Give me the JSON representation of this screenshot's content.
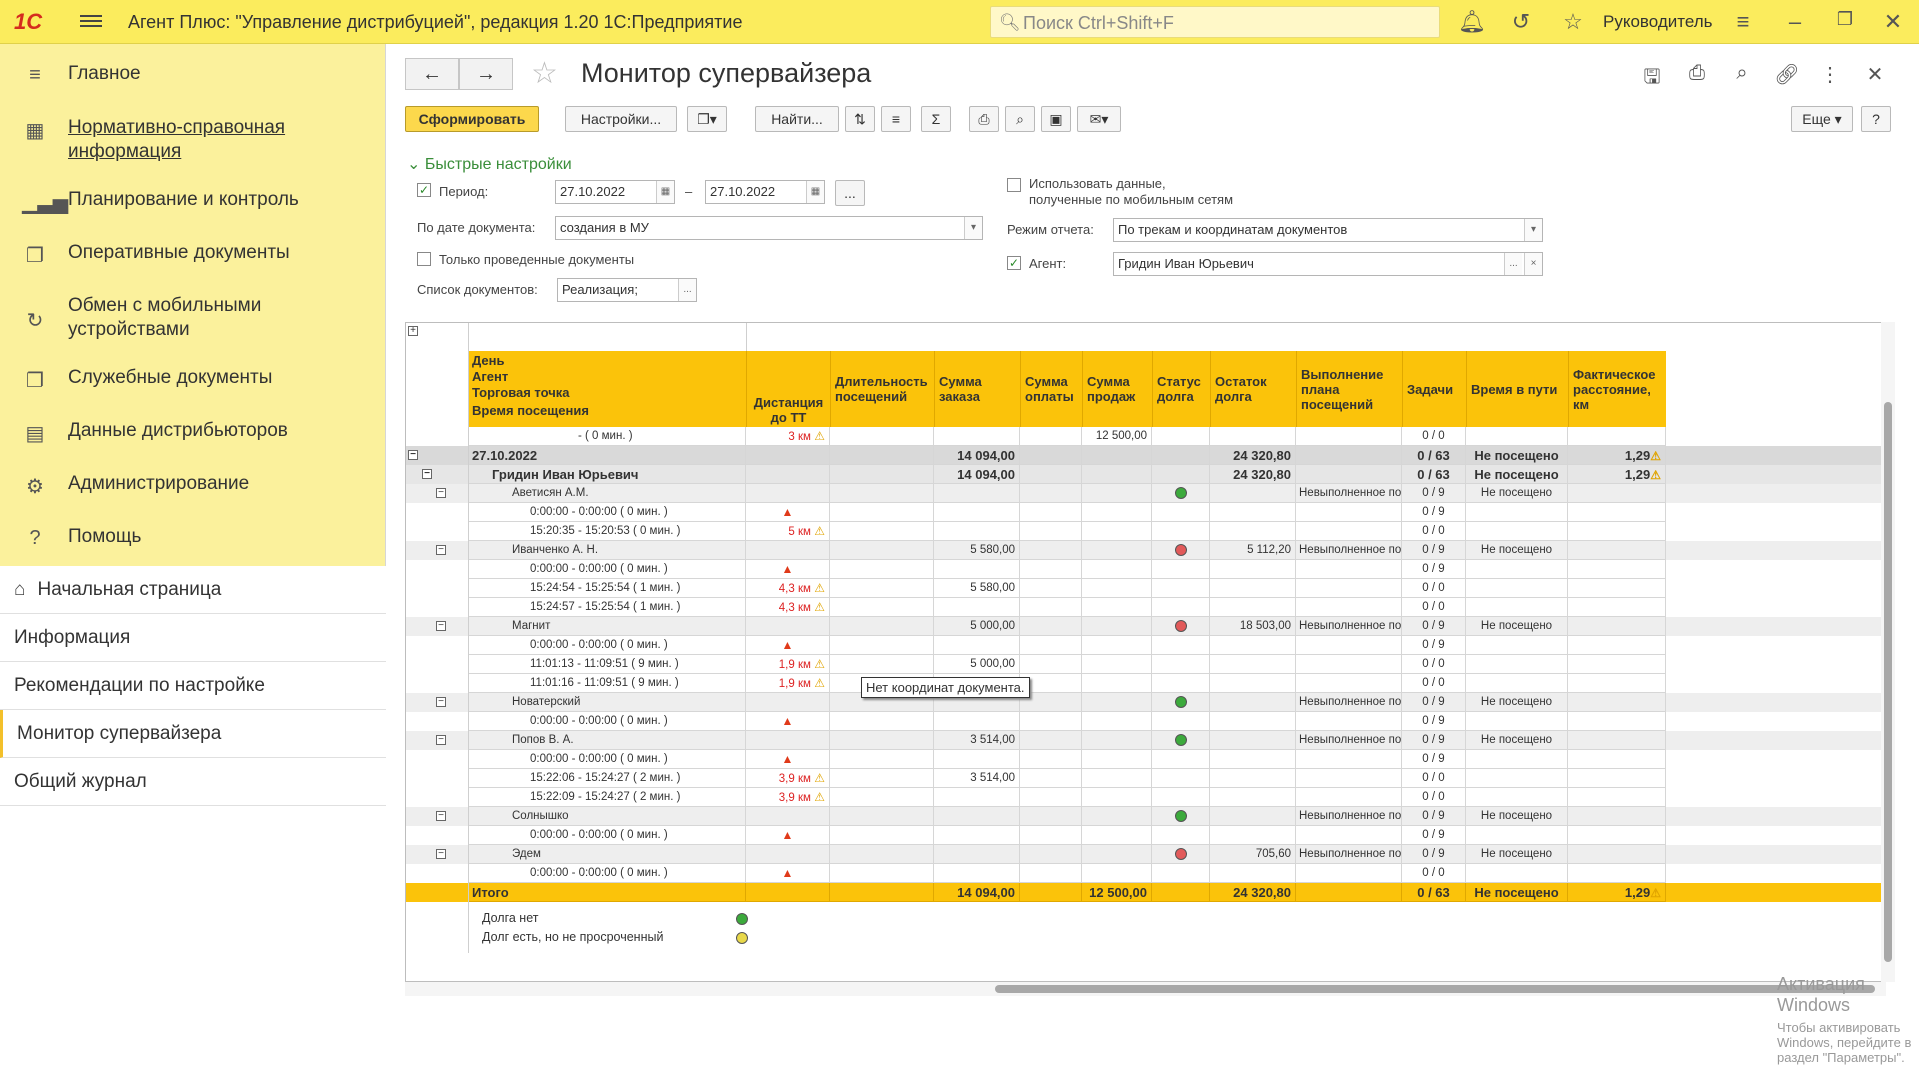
{
  "topbar": {
    "logo": "1С",
    "title": "Агент Плюс: \"Управление дистрибуцией\", редакция 1.20 1С:Предприятие",
    "search_placeholder": "Поиск Ctrl+Shift+F",
    "user": "Руководитель"
  },
  "sidebar": {
    "items": [
      {
        "icon": "menu-icon",
        "label": "Главное"
      },
      {
        "icon": "catalog-icon",
        "label": "Нормативно-справочная информация"
      },
      {
        "icon": "chart-icon",
        "label": "Планирование и контроль"
      },
      {
        "icon": "docs-icon",
        "label": "Оперативные документы"
      },
      {
        "icon": "sync-icon",
        "label": "Обмен с мобильными устройствами"
      },
      {
        "icon": "service-docs-icon",
        "label": "Служебные документы"
      },
      {
        "icon": "distributor-icon",
        "label": "Данные дистрибьюторов"
      },
      {
        "icon": "gear-icon",
        "label": "Администрирование"
      },
      {
        "icon": "help-icon",
        "label": "Помощь"
      }
    ],
    "nav": [
      {
        "label": "Начальная страница"
      },
      {
        "label": "Информация"
      },
      {
        "label": "Рекомендации по настройке"
      },
      {
        "label": "Монитор супервайзера"
      },
      {
        "label": "Общий журнал"
      }
    ]
  },
  "form": {
    "title": "Монитор супервайзера",
    "buttons": {
      "generate": "Сформировать",
      "settings": "Настройки...",
      "find": "Найти...",
      "more": "Еще",
      "help": "?"
    },
    "quick_settings": "Быстрые настройки",
    "period_label": "Период:",
    "date_from": "27.10.2022",
    "date_to": "27.10.2022",
    "period_sep": "–",
    "period_more": "...",
    "by_date_label": "По дате документа:",
    "by_date_value": "создания в МУ",
    "only_posted": "Только проведенные документы",
    "doc_list_label": "Список документов:",
    "doc_list_value": "Реализация; Приходны",
    "use_mobile": "Использовать данные,",
    "use_mobile2": "полученные по мобильным сетям",
    "report_mode_label": "Режим отчета:",
    "report_mode_value": "По трекам и координатам документов",
    "agent_label": "Агент:",
    "agent_value": "Гридин Иван Юрьевич"
  },
  "table": {
    "group_headers": [
      "День",
      "Агент",
      "Торговая точка",
      "Время посещения"
    ],
    "columns": [
      "Дистанция до ТТ",
      "Длительность посещений",
      "Сумма заказа",
      "Сумма оплаты",
      "Сумма продаж",
      "Статус долга",
      "Остаток долга",
      "Выполнение плана посещений",
      "Задачи",
      "Время в пути",
      "Фактическое расстояние, км"
    ],
    "rows": [
      {
        "kind": "plain",
        "name": "- ( 0 мин. )",
        "dist": "3 км",
        "warn": true,
        "sales": "12 500,00",
        "tasks": "0 / 0"
      },
      {
        "kind": "day",
        "name": "27.10.2022",
        "order": "14 094,00",
        "debt": "24 320,80",
        "tasks": "0 / 63",
        "travel": "Не посещено",
        "km": "1,29"
      },
      {
        "kind": "agent",
        "name": "Гридин Иван Юрьевич",
        "order": "14 094,00",
        "debt": "24 320,80",
        "tasks": "0 / 63",
        "travel": "Не посещено",
        "km": "1,29"
      },
      {
        "kind": "tt",
        "name": "Аветисян А.М.",
        "status": "green",
        "plan": "Невыполненное посе",
        "tasks": "0 / 9",
        "travel": "Не посещено"
      },
      {
        "kind": "time",
        "name": "0:00:00 - 0:00:00 ( 0 мин. )",
        "tri": true,
        "tasks": "0 / 9"
      },
      {
        "kind": "time",
        "name": "15:20:35 - 15:20:53 ( 0 мин. )",
        "dist": "5 км",
        "warn": true,
        "tasks": "0 / 0"
      },
      {
        "kind": "tt",
        "name": "Иванченко А. Н.",
        "order": "5 580,00",
        "status": "red",
        "debt": "5 112,20",
        "plan": "Невыполненное посе",
        "tasks": "0 / 9",
        "travel": "Не посещено"
      },
      {
        "kind": "time",
        "name": "0:00:00 - 0:00:00 ( 0 мин. )",
        "tri": true,
        "tasks": "0 / 9"
      },
      {
        "kind": "time",
        "name": "15:24:54 - 15:25:54 ( 1 мин. )",
        "dist": "4,3 км",
        "warn": true,
        "order": "5 580,00",
        "tasks": "0 / 0"
      },
      {
        "kind": "time",
        "name": "15:24:57 - 15:25:54 ( 1 мин. )",
        "dist": "4,3 км",
        "warn": true,
        "tasks": "0 / 0"
      },
      {
        "kind": "tt",
        "name": "Магнит",
        "order": "5 000,00",
        "status": "red",
        "debt": "18 503,00",
        "plan": "Невыполненное посе",
        "tasks": "0 / 9",
        "travel": "Не посещено"
      },
      {
        "kind": "time",
        "name": "0:00:00 - 0:00:00 ( 0 мин. )",
        "tri": true,
        "tasks": "0 / 9"
      },
      {
        "kind": "time",
        "name": "11:01:13 - 11:09:51 ( 9 мин. )",
        "dist": "1,9 км",
        "warn": true,
        "order": "5 000,00",
        "tasks": "0 / 0"
      },
      {
        "kind": "time",
        "name": "11:01:16 - 11:09:51 ( 9 мин. )",
        "dist": "1,9 км",
        "warn": true,
        "tasks": "0 / 0"
      },
      {
        "kind": "tt",
        "name": "Новатерский",
        "status": "green",
        "plan": "Невыполненное посе",
        "tasks": "0 / 9",
        "travel": "Не посещено"
      },
      {
        "kind": "time",
        "name": "0:00:00 - 0:00:00 ( 0 мин. )",
        "tri": true,
        "tasks": "0 / 9"
      },
      {
        "kind": "tt",
        "name": "Попов В. А.",
        "order": "3 514,00",
        "status": "green",
        "plan": "Невыполненное посе",
        "tasks": "0 / 9",
        "travel": "Не посещено"
      },
      {
        "kind": "time",
        "name": "0:00:00 - 0:00:00 ( 0 мин. )",
        "tri": true,
        "tasks": "0 / 9"
      },
      {
        "kind": "time",
        "name": "15:22:06 - 15:24:27 ( 2 мин. )",
        "dist": "3,9 км",
        "warn": true,
        "order": "3 514,00",
        "tasks": "0 / 0"
      },
      {
        "kind": "time",
        "name": "15:22:09 - 15:24:27 ( 2 мин. )",
        "dist": "3,9 км",
        "warn": true,
        "tasks": "0 / 0"
      },
      {
        "kind": "tt",
        "name": "Солнышко",
        "status": "green",
        "plan": "Невыполненное посе",
        "tasks": "0 / 9",
        "travel": "Не посещено"
      },
      {
        "kind": "time",
        "name": "0:00:00 - 0:00:00 ( 0 мин. )",
        "tri": true,
        "tasks": "0 / 9"
      },
      {
        "kind": "tt",
        "name": "Эдем",
        "status": "red",
        "debt": "705,60",
        "plan": "Невыполненное посе",
        "tasks": "0 / 9",
        "travel": "Не посещено"
      },
      {
        "kind": "time",
        "name": "0:00:00 - 0:00:00 ( 0 мин. )",
        "tri": true,
        "tasks": "0 / 0"
      }
    ],
    "total": {
      "name": "Итого",
      "order": "14 094,00",
      "sales": "12 500,00",
      "debt": "24 320,80",
      "tasks": "0 / 63",
      "travel": "Не посещено",
      "km": "1,29"
    },
    "legend": [
      {
        "label": "Долга нет",
        "color": "green"
      },
      {
        "label": "Долг есть, но не просроченный",
        "color": "yellow"
      }
    ],
    "tooltip": "Нет координат документа."
  },
  "watermark": {
    "title": "Активация Windows",
    "text": "Чтобы активировать Windows, перейдите в раздел \"Параметры\"."
  }
}
